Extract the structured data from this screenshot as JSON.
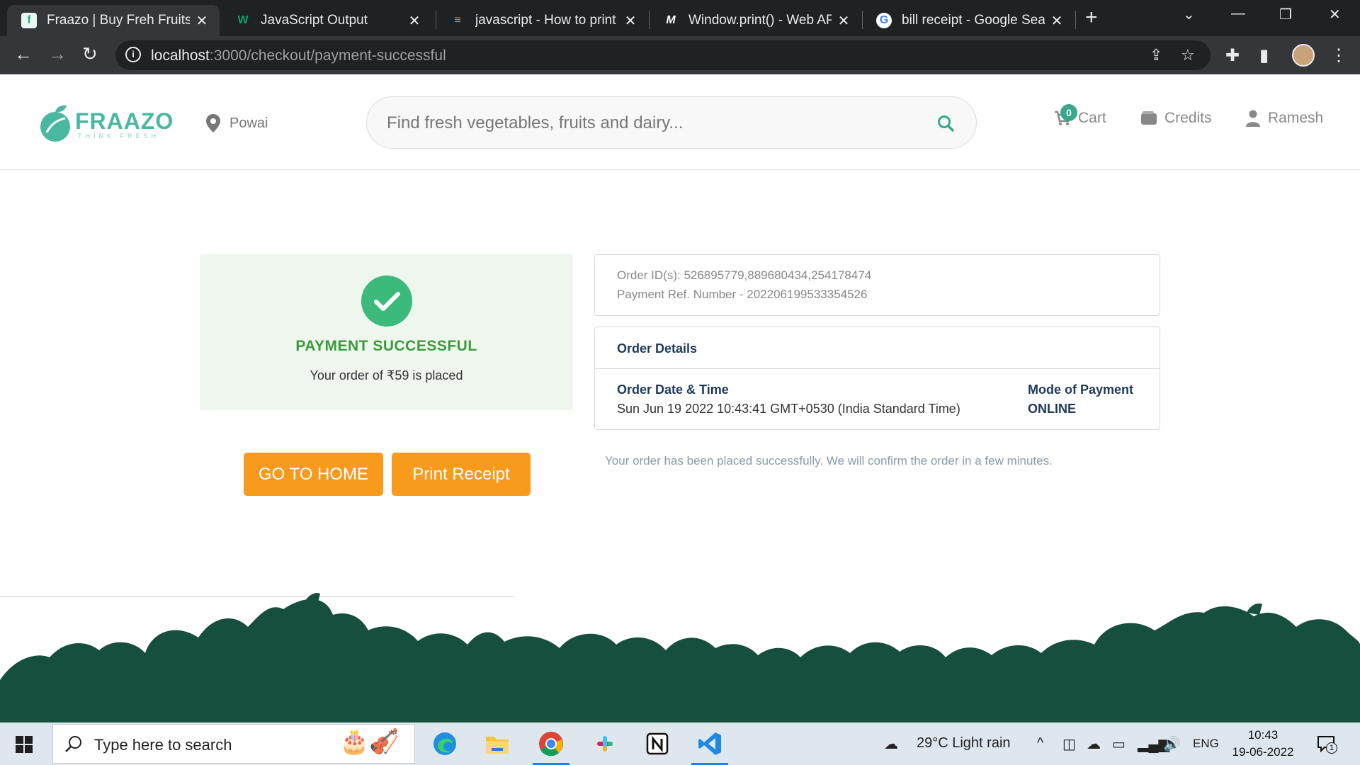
{
  "browser": {
    "tabs": [
      {
        "title": "Fraazo | Buy Freh Fruits &",
        "active": true,
        "icon": "fraazo-favicon"
      },
      {
        "title": "JavaScript Output",
        "active": false,
        "icon": "w3schools-favicon"
      },
      {
        "title": "javascript - How to print P",
        "active": false,
        "icon": "stackoverflow-favicon"
      },
      {
        "title": "Window.print() - Web API",
        "active": false,
        "icon": "mdn-favicon"
      },
      {
        "title": "bill receipt - Google Searc",
        "active": false,
        "icon": "google-favicon"
      }
    ],
    "url_host": "localhost",
    "url_path": ":3000/checkout/payment-successful"
  },
  "header": {
    "brand": "FRAAZO",
    "tagline": "THINK FRESH",
    "location": "Powai",
    "search_placeholder": "Find fresh vegetables, fruits and dairy...",
    "cart_label": "Cart",
    "cart_count": "0",
    "credits_label": "Credits",
    "user_label": "Ramesh"
  },
  "payment": {
    "status_title": "PAYMENT SUCCESSFUL",
    "status_sub": "Your order of ₹59 is placed",
    "home_button": "GO TO HOME",
    "print_button": "Print Receipt",
    "order_ids": "Order ID(s): 526895779,889680434,254178474",
    "payment_ref": "Payment Ref. Number - 202206199533354526",
    "details_title": "Order Details",
    "date_label": "Order Date & Time",
    "date_value": "Sun Jun 19 2022 10:43:41 GMT+0530 (India Standard Time)",
    "mode_label": "Mode of Payment",
    "mode_value": "ONLINE",
    "confirm_note": "Your order has been placed successfully. We will confirm the order in a few minutes."
  },
  "taskbar": {
    "search_placeholder": "Type here to search",
    "weather": "29°C  Light rain",
    "language": "ENG",
    "time": "10:43",
    "date": "19-06-2022",
    "notification_count": "1",
    "apps": [
      "edge-icon",
      "file-explorer-icon",
      "chrome-icon",
      "slack-icon",
      "notion-icon",
      "vscode-icon"
    ]
  },
  "colors": {
    "brand_green": "#4ab8a0",
    "success_green": "#3cba7c",
    "button_orange": "#f89a1c",
    "footer_green": "#174f3f",
    "heading_navy": "#1e3a5a"
  }
}
